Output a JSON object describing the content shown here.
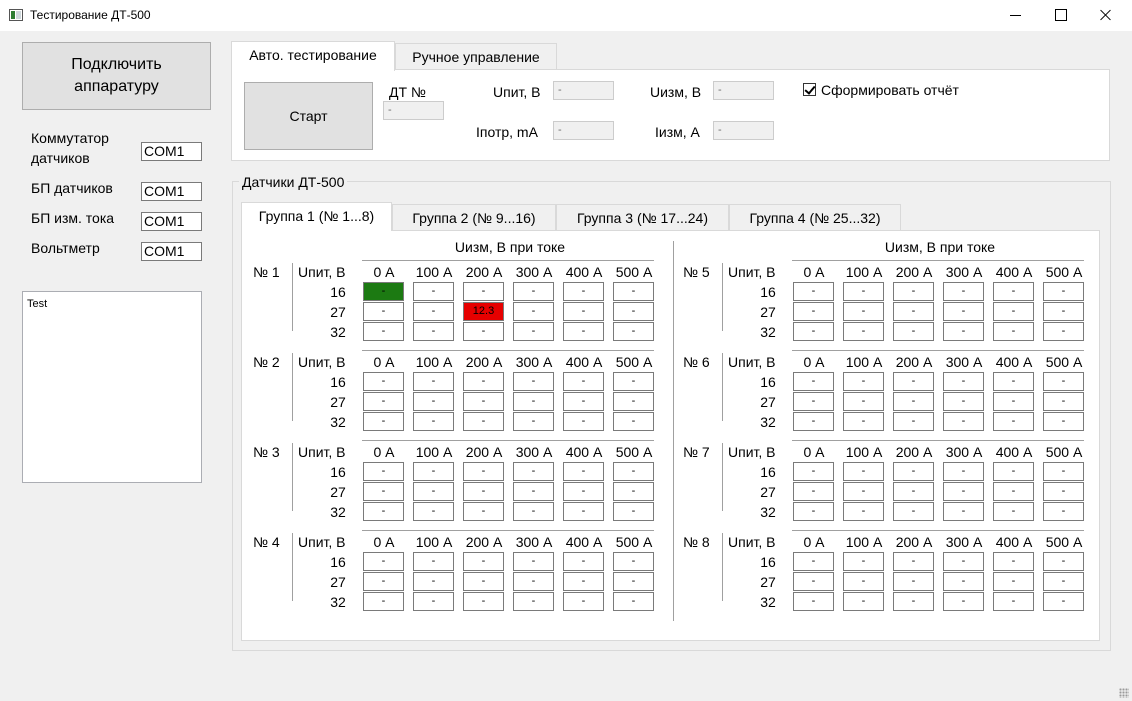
{
  "window": {
    "title": "Тестирование ДТ-500",
    "minimize_icon": "minimize-icon",
    "maximize_icon": "maximize-icon",
    "close_icon": "close-icon"
  },
  "left": {
    "connect_label_line1": "Подключить",
    "connect_label_line2": "аппаратуру",
    "ports": [
      {
        "label_line1": "Коммутатор",
        "label_line2": "датчиков",
        "value": "COM1"
      },
      {
        "label_line1": "БП датчиков",
        "label_line2": "",
        "value": "COM1"
      },
      {
        "label_line1": "БП изм. тока",
        "label_line2": "",
        "value": "COM1"
      },
      {
        "label_line1": "Вольтметр",
        "label_line2": "",
        "value": "COM1"
      }
    ],
    "log_text": "Test"
  },
  "main_tabs": [
    "Авто. тестирование",
    "Ручное управление"
  ],
  "auto": {
    "start_label": "Старт",
    "dt_label": "ДТ №",
    "dt_value": "-",
    "upit_label": "Uпит, В",
    "upit_value": "-",
    "ipotr_label": "Iпотр, mA",
    "ipotr_value": "-",
    "uizm_label": "Uизм, В",
    "uizm_value": "-",
    "iizm_label": "Iизм, А",
    "iizm_value": "-",
    "report_label": "Сформировать отчёт",
    "report_checked": true
  },
  "sensors": {
    "groupbox_title": "Датчики ДТ-500",
    "group_tabs": [
      "Группа 1 (№ 1...8)",
      "Группа 2  (№ 9...16)",
      "Группа 3  (№ 17...24)",
      "Группа 4  (№ 25...32)"
    ],
    "column_title": "Uизм, В при токе",
    "upit_header": "Uпит, В",
    "currents": [
      "0 А",
      "100 А",
      "200 А",
      "300 А",
      "400 А",
      "500 А"
    ],
    "voltages": [
      "16",
      "27",
      "32"
    ],
    "empty_value": "-",
    "sensor_labels": [
      "№ 1",
      "№ 2",
      "№ 3",
      "№ 4",
      "№ 5",
      "№ 6",
      "№ 7",
      "№ 8"
    ],
    "special_cells": [
      {
        "sensor": 1,
        "voltage_row": 0,
        "current_col": 0,
        "value": "-",
        "status": "pass",
        "color": "#1c7a12"
      },
      {
        "sensor": 1,
        "voltage_row": 1,
        "current_col": 2,
        "value": "12.3",
        "status": "fail",
        "color": "#e60000"
      }
    ]
  }
}
